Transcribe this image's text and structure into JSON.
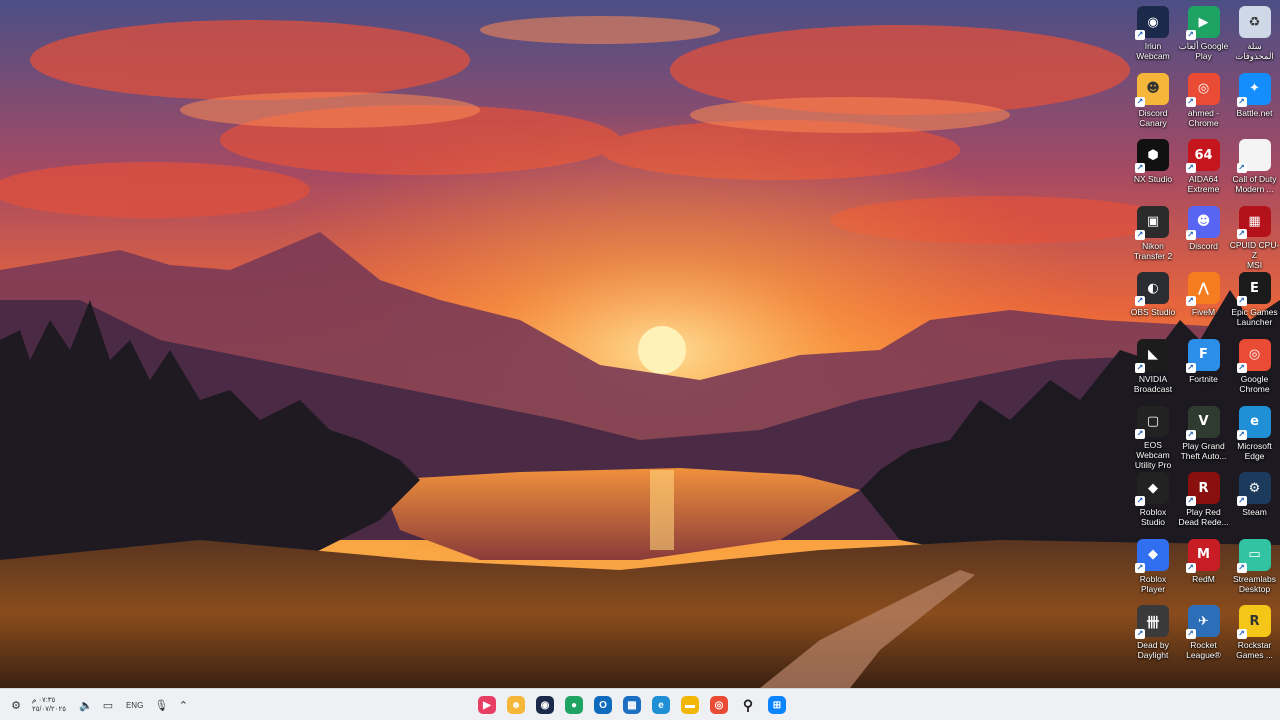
{
  "desktop": {
    "icons": [
      {
        "label": "Recycle Bin (سلة المحذوفات)",
        "text": "سلة\nالمحذوفات",
        "icon": "recycle-bin-icon",
        "color": "#cfd8e6",
        "glyph": "♻"
      },
      {
        "label": "ألعاب Google Play",
        "text": "ألعاب Google\nPlay",
        "icon": "google-play-games-icon",
        "color": "#1ea362",
        "glyph": "▶"
      },
      {
        "label": "Iriun Webcam",
        "text": "Iriun\nWebcam",
        "icon": "iriun-webcam-icon",
        "color": "#1b2a4a",
        "glyph": "◉"
      },
      {
        "label": "Battle.net",
        "text": "Battle.net",
        "icon": "battle-net-icon",
        "color": "#148eff",
        "glyph": "✦"
      },
      {
        "label": "ahmed - Chrome",
        "text": "ahmed -\nChrome",
        "icon": "chrome-icon",
        "color": "#e94b35",
        "glyph": "◎"
      },
      {
        "label": "Discord Canary",
        "text": "Discord\nCanary",
        "icon": "discord-canary-icon",
        "color": "#f5b63a",
        "glyph": "☻"
      },
      {
        "label": "Call of Duty Modern ...",
        "text": "Call of Duty\nModern ...",
        "icon": "file-icon",
        "color": "#f4f4f4",
        "glyph": ""
      },
      {
        "label": "AIDA64 Extreme",
        "text": "AIDA64\nExtreme",
        "icon": "aida64-icon",
        "color": "#c4161c",
        "glyph": "64"
      },
      {
        "label": "NX Studio",
        "text": "NX Studio",
        "icon": "nx-studio-icon",
        "color": "#111111",
        "glyph": "⬢"
      },
      {
        "label": "CPUID CPU-Z MSI",
        "text": "CPUID CPU-Z\nMSI",
        "icon": "cpu-z-icon",
        "color": "#b3121a",
        "glyph": "▦"
      },
      {
        "label": "Discord",
        "text": "Discord",
        "icon": "discord-icon",
        "color": "#5865f2",
        "glyph": "☻"
      },
      {
        "label": "Nikon Transfer 2",
        "text": "Nikon\nTransfer 2",
        "icon": "nikon-transfer-icon",
        "color": "#2b2b2b",
        "glyph": "▣"
      },
      {
        "label": "Epic Games Launcher",
        "text": "Epic Games\nLauncher",
        "icon": "epic-games-icon",
        "color": "#1b1b1b",
        "glyph": "E"
      },
      {
        "label": "FiveM",
        "text": "FiveM",
        "icon": "fivem-icon",
        "color": "#f57c1f",
        "glyph": "⋀"
      },
      {
        "label": "OBS Studio",
        "text": "OBS Studio",
        "icon": "obs-icon",
        "color": "#2b2d33",
        "glyph": "◐"
      },
      {
        "label": "Google Chrome",
        "text": "Google\nChrome",
        "icon": "chrome-icon",
        "color": "#e94b35",
        "glyph": "◎"
      },
      {
        "label": "Fortnite",
        "text": "Fortnite",
        "icon": "fortnite-icon",
        "color": "#2b8ee8",
        "glyph": "F"
      },
      {
        "label": "NVIDIA Broadcast",
        "text": "NVIDIA\nBroadcast",
        "icon": "nvidia-broadcast-icon",
        "color": "#1c1c1c",
        "glyph": "◣"
      },
      {
        "label": "Microsoft Edge",
        "text": "Microsoft\nEdge",
        "icon": "edge-icon",
        "color": "#1f8fd6",
        "glyph": "e"
      },
      {
        "label": "Play Grand Theft Auto...",
        "text": "Play Grand\nTheft Auto...",
        "icon": "gta-icon",
        "color": "#2e3b2e",
        "glyph": "V"
      },
      {
        "label": "EOS Webcam Utility Pro",
        "text": "EOS Webcam\nUtility Pro",
        "icon": "eos-webcam-icon",
        "color": "#222222",
        "glyph": "▢"
      },
      {
        "label": "Steam",
        "text": "Steam",
        "icon": "steam-icon",
        "color": "#1b3a5c",
        "glyph": "⚙"
      },
      {
        "label": "Play Red Dead Rede...",
        "text": "Play Red\nDead Rede...",
        "icon": "rdr2-icon",
        "color": "#8a1010",
        "glyph": "R"
      },
      {
        "label": "Roblox Studio",
        "text": "Roblox\nStudio",
        "icon": "roblox-studio-icon",
        "color": "#222222",
        "glyph": "◆"
      },
      {
        "label": "Streamlabs Desktop",
        "text": "Streamlabs\nDesktop",
        "icon": "streamlabs-icon",
        "color": "#31c3a2",
        "glyph": "▭"
      },
      {
        "label": "RedM",
        "text": "RedM",
        "icon": "redm-icon",
        "color": "#c81d25",
        "glyph": "M"
      },
      {
        "label": "Roblox Player",
        "text": "Roblox Player",
        "icon": "roblox-player-icon",
        "color": "#2f6ff0",
        "glyph": "◆"
      },
      {
        "label": "Rockstar Games ...",
        "text": "Rockstar\nGames ...",
        "icon": "rockstar-icon",
        "color": "#f5c518",
        "glyph": "R"
      },
      {
        "label": "Rocket League®",
        "text": "Rocket\nLeague®",
        "icon": "rocket-league-icon",
        "color": "#2c6fb8",
        "glyph": "✈"
      },
      {
        "label": "Dead by Daylight",
        "text": "Dead by\nDaylight",
        "icon": "dead-by-daylight-icon",
        "color": "#3a3a3a",
        "glyph": "卌"
      }
    ]
  },
  "taskbar": {
    "time": "٠٧:٣٥ م",
    "date": "٢٥/٠٧/٢٠٢٥",
    "language": "ENG",
    "pinned": [
      {
        "name": "google-play-games-taskbar-icon",
        "color": "#e83e64",
        "glyph": "▶"
      },
      {
        "name": "discord-canary-taskbar-icon",
        "color": "#f5b63a",
        "glyph": "☻"
      },
      {
        "name": "iriun-webcam-taskbar-icon",
        "color": "#1b2a4a",
        "glyph": "◉"
      },
      {
        "name": "chat-app-taskbar-icon",
        "color": "#1ea362",
        "glyph": "●"
      },
      {
        "name": "outlook-taskbar-icon",
        "color": "#0f6cbd",
        "glyph": "O"
      },
      {
        "name": "store-taskbar-icon",
        "color": "#1b6ec2",
        "glyph": "▦"
      },
      {
        "name": "edge-taskbar-icon",
        "color": "#1f8fd6",
        "glyph": "e"
      },
      {
        "name": "file-explorer-taskbar-icon",
        "color": "#f2b705",
        "glyph": "▬"
      },
      {
        "name": "chrome-taskbar-icon",
        "color": "#e94b35",
        "glyph": "◎"
      },
      {
        "name": "search-taskbar-icon",
        "color": "transparent",
        "glyph": "⚲"
      },
      {
        "name": "start-taskbar-icon",
        "color": "#0a84ff",
        "glyph": "⊞"
      }
    ]
  }
}
